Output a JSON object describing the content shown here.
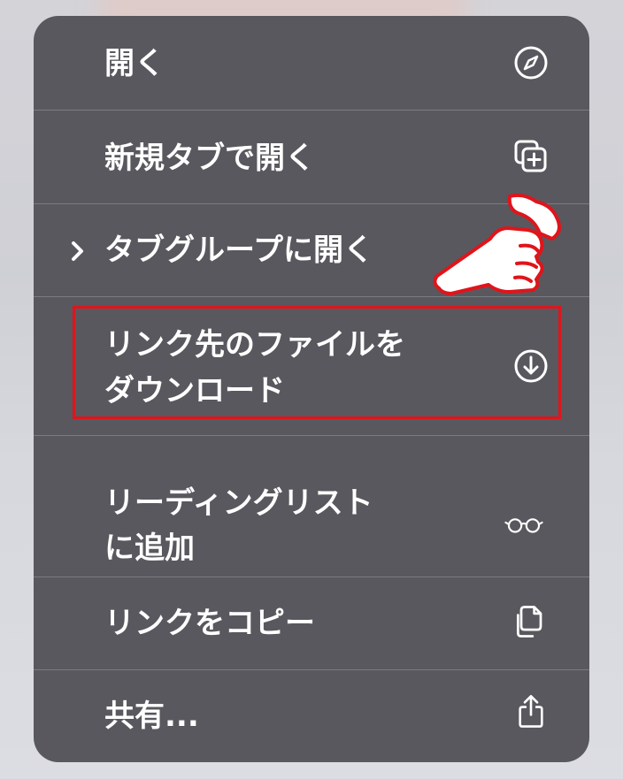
{
  "menu": {
    "items": [
      {
        "id": "open",
        "lines": [
          "開く"
        ],
        "icon": "compass-icon"
      },
      {
        "id": "open-new-tab",
        "lines": [
          "新規タブで開く"
        ],
        "icon": "new-tab-icon"
      },
      {
        "id": "open-tab-group",
        "lines": [
          "タブグループに開く"
        ],
        "icon": "",
        "has_submenu": true
      },
      {
        "id": "download-linked-file",
        "lines": [
          "リンク先のファイルを",
          "ダウンロード"
        ],
        "icon": "download-icon",
        "highlighted": true
      },
      {
        "id": "add-reading-list",
        "lines": [
          "リーディングリスト",
          "に追加"
        ],
        "icon": "glasses-icon"
      },
      {
        "id": "copy-link",
        "lines": [
          "リンクをコピー"
        ],
        "icon": "copy-icon"
      },
      {
        "id": "share",
        "lines": [
          "共有..."
        ],
        "icon": "share-icon"
      }
    ]
  },
  "colors": {
    "menu_bg": "#58585e",
    "text": "#ffffff",
    "separator": "#7b7b82",
    "highlight_border": "#e0141b"
  },
  "annotation": {
    "pointer": "pointing-hand-icon"
  }
}
